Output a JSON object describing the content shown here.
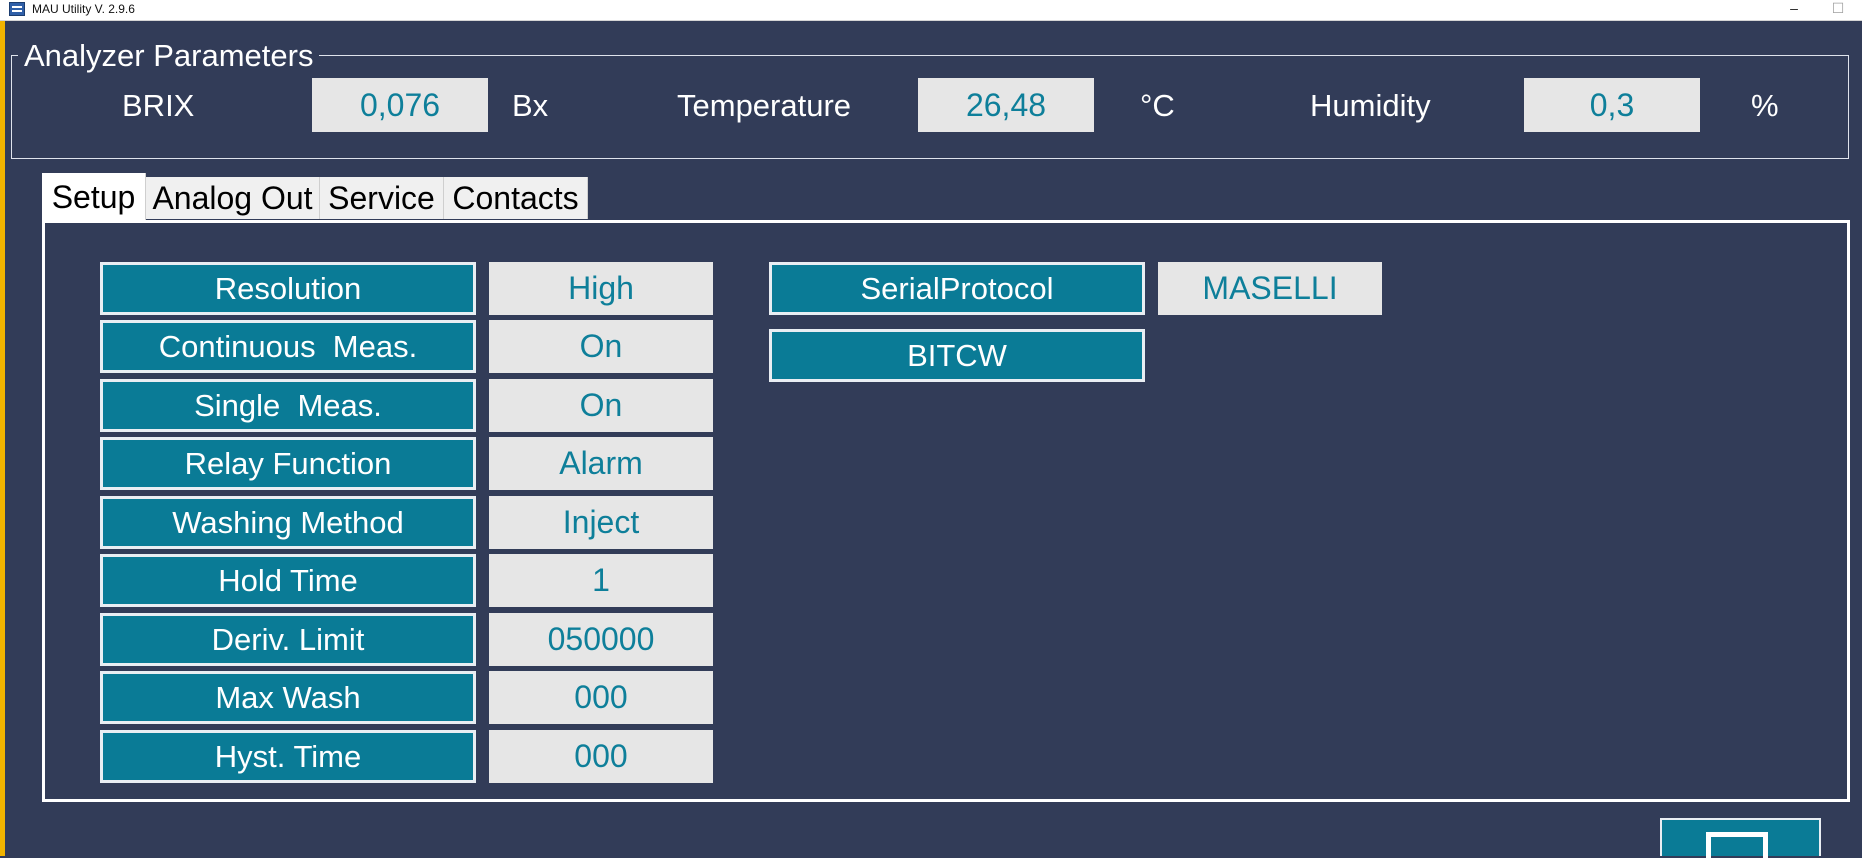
{
  "window": {
    "title": "MAU Utility V. 2.9.6",
    "minimize_glyph": "–",
    "maximize_glyph": "☐"
  },
  "analyzer": {
    "title": "Analyzer Parameters",
    "brix": {
      "label": "BRIX",
      "value": "0,076",
      "unit": "Bx"
    },
    "temperature": {
      "label": "Temperature",
      "value": "26,48",
      "unit": "°C"
    },
    "humidity": {
      "label": "Humidity",
      "value": "0,3",
      "unit": "%"
    }
  },
  "tabs": [
    {
      "label": "Setup",
      "active": true
    },
    {
      "label": "Analog Out",
      "active": false
    },
    {
      "label": "Service",
      "active": false
    },
    {
      "label": "Contacts",
      "active": false
    }
  ],
  "setup": {
    "settings": [
      {
        "label": "Resolution",
        "value": "High"
      },
      {
        "label": "Continuous  Meas.",
        "value": "On"
      },
      {
        "label": "Single  Meas.",
        "value": "On"
      },
      {
        "label": "Relay Function",
        "value": "Alarm"
      },
      {
        "label": "Washing Method",
        "value": "Inject"
      },
      {
        "label": "Hold Time",
        "value": "1"
      },
      {
        "label": "Deriv. Limit",
        "value": "050000"
      },
      {
        "label": "Max Wash",
        "value": "000"
      },
      {
        "label": "Hyst. Time",
        "value": "000"
      }
    ],
    "serial_protocol": {
      "label": "SerialProtocol",
      "value": "MASELLI"
    },
    "bitcw": {
      "label": "BITCW"
    }
  },
  "colors": {
    "background": "#323c58",
    "button": "#0a7b96",
    "value_text": "#0e7f9a",
    "value_box": "#e6e6e6"
  }
}
